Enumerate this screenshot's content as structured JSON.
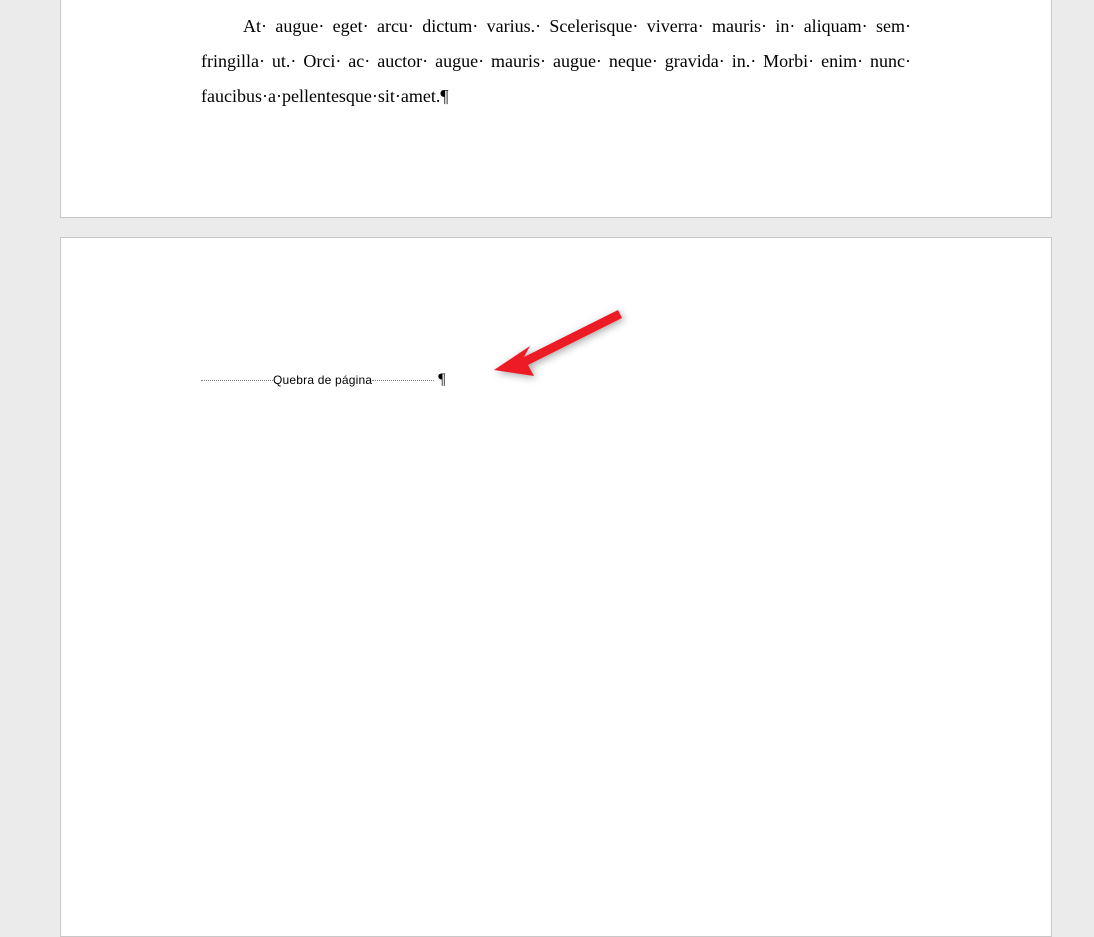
{
  "document": {
    "paragraphs": [
      {
        "text_with_marks": "At· augue· eget· arcu· dictum· varius.· Scelerisque· viverra· mauris· in· aliquam· sem· fringilla· ut.· Orci· ac· auctor· augue· mauris· augue· neque· gravida· in.· Morbi· enim· nunc· faucibus·a·pellentesque·sit·amet.¶"
      }
    ],
    "page_break": {
      "label": "Quebra de página",
      "pilcrow": "¶"
    }
  },
  "annotation": {
    "arrow_color": "#ed1c24"
  }
}
